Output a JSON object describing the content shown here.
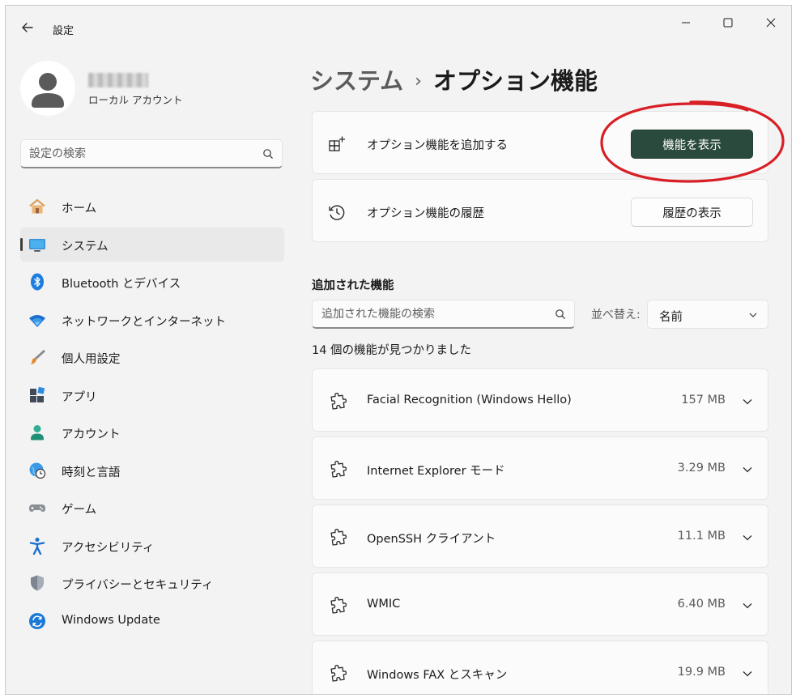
{
  "window": {
    "title": "設定"
  },
  "profile": {
    "account_type": "ローカル アカウント"
  },
  "sidebar": {
    "search_placeholder": "設定の検索",
    "items": [
      {
        "label": "ホーム",
        "icon": "home-icon"
      },
      {
        "label": "システム",
        "icon": "system-monitor-icon",
        "active": true
      },
      {
        "label": "Bluetooth とデバイス",
        "icon": "bluetooth-icon"
      },
      {
        "label": "ネットワークとインターネット",
        "icon": "wifi-icon"
      },
      {
        "label": "個人用設定",
        "icon": "paintbrush-icon"
      },
      {
        "label": "アプリ",
        "icon": "apps-icon"
      },
      {
        "label": "アカウント",
        "icon": "person-icon"
      },
      {
        "label": "時刻と言語",
        "icon": "globe-clock-icon"
      },
      {
        "label": "ゲーム",
        "icon": "gamepad-icon"
      },
      {
        "label": "アクセシビリティ",
        "icon": "accessibility-icon"
      },
      {
        "label": "プライバシーとセキュリティ",
        "icon": "shield-icon"
      },
      {
        "label": "Windows Update",
        "icon": "windows-update-icon"
      }
    ]
  },
  "breadcrumb": {
    "parent": "システム",
    "separator": "›",
    "current": "オプション機能"
  },
  "add_feature": {
    "label": "オプション機能を追加する",
    "button": "機能を表示"
  },
  "history": {
    "label": "オプション機能の履歴",
    "button": "履歴の表示"
  },
  "installed": {
    "heading": "追加された機能",
    "search_placeholder": "追加された機能の検索",
    "sort_label": "並べ替え:",
    "sort_value": "名前",
    "count_text": "14 個の機能が見つかりました",
    "features": [
      {
        "name": "Facial Recognition (Windows Hello)",
        "size": "157 MB"
      },
      {
        "name": "Internet Explorer モード",
        "size": "3.29 MB"
      },
      {
        "name": "OpenSSH クライアント",
        "size": "11.1 MB"
      },
      {
        "name": "WMIC",
        "size": "6.40 MB"
      },
      {
        "name": "Windows FAX とスキャン",
        "size": "19.9 MB"
      }
    ]
  },
  "colors": {
    "accent": "#2b4a3e",
    "annotation": "#d81f26",
    "background": "#f3f3f3",
    "card": "#fbfbfb"
  }
}
